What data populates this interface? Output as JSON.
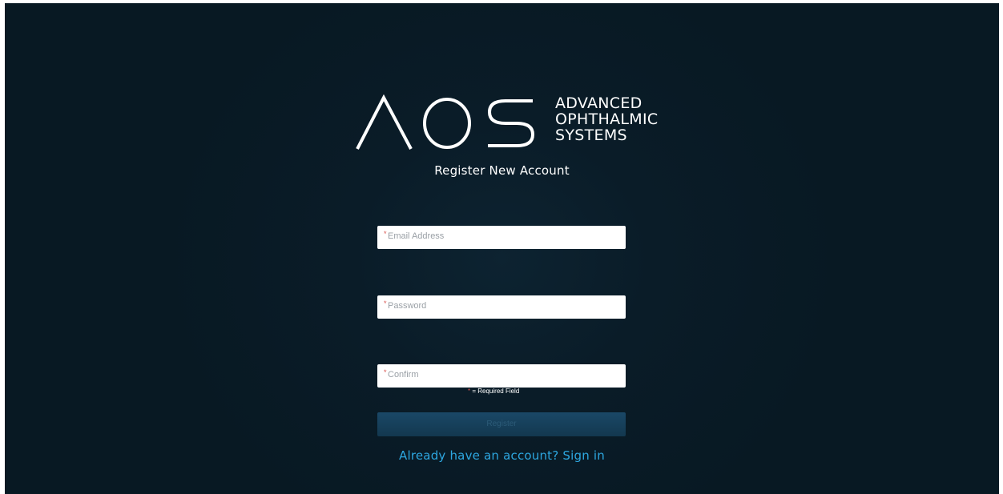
{
  "brand": {
    "mark": "AOS",
    "line1": "ADVANCED",
    "line2": "OPHTHALMIC",
    "line3": "SYSTEMS"
  },
  "page_title": "Register New Account",
  "form": {
    "email": {
      "star": "*",
      "placeholder": "Email Address",
      "value": ""
    },
    "password": {
      "star": "*",
      "placeholder": "Password",
      "value": ""
    },
    "confirm": {
      "star": "*",
      "placeholder": "Confirm",
      "value": ""
    },
    "required_note_star": "*",
    "required_note_text": "= Required Field",
    "submit_label": "Register"
  },
  "signin_link": "Already have an account? Sign in",
  "colors": {
    "background": "#081923",
    "link": "#2da7e0",
    "required": "#d9534f",
    "button": "#1a4867"
  }
}
